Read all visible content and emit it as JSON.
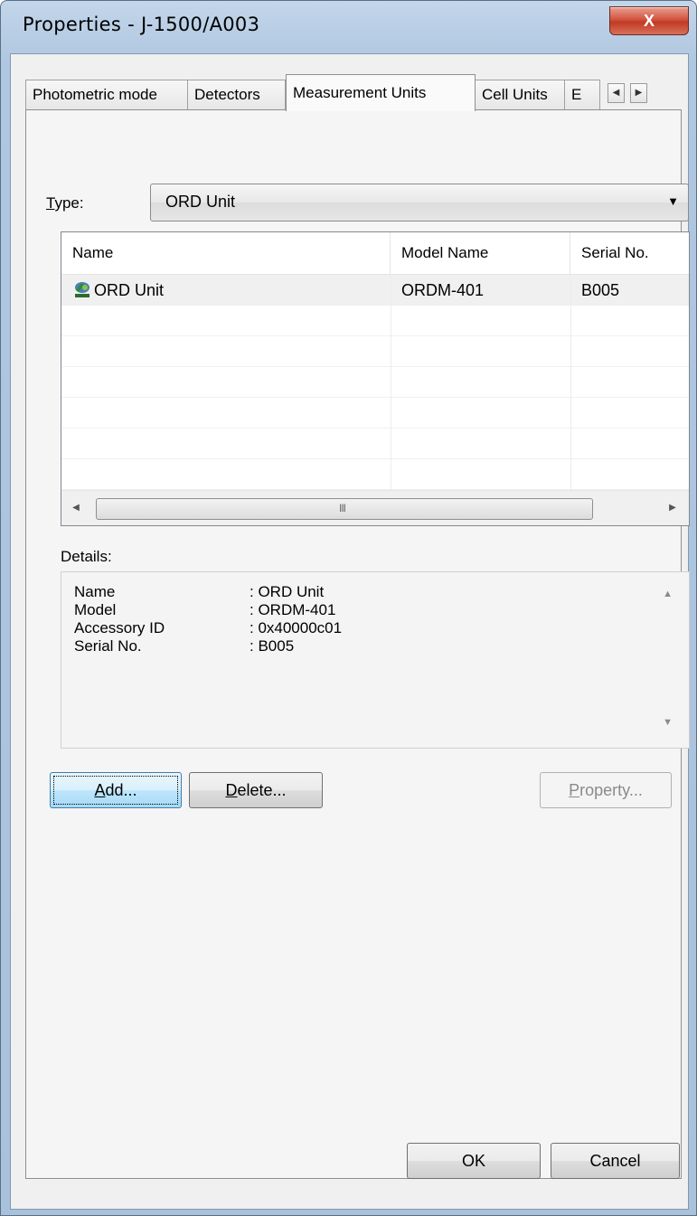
{
  "window": {
    "title": "Properties - J-1500/A003",
    "close_glyph": "X"
  },
  "tabs": [
    {
      "label": "Photometric mode"
    },
    {
      "label": "Detectors"
    },
    {
      "label": "Measurement Units"
    },
    {
      "label": "Cell Units"
    },
    {
      "label": "E"
    }
  ],
  "tab_scroll": {
    "left": "◀",
    "right": "▶"
  },
  "type_field": {
    "label_prefix": "T",
    "label_rest": "ype:",
    "value": "ORD Unit",
    "arrow": "▼"
  },
  "units_table": {
    "columns": [
      "Name",
      "Model Name",
      "Serial No."
    ],
    "rows": [
      {
        "name": "ORD Unit",
        "model": "ORDM-401",
        "serial": "B005",
        "icon": "accessory-icon"
      }
    ],
    "scroll": {
      "left": "◀",
      "right": "▶",
      "grip": "III"
    }
  },
  "details": {
    "label": "Details:",
    "fields": [
      {
        "key": "Name",
        "value": ": ORD Unit"
      },
      {
        "key": "Model",
        "value": ": ORDM-401"
      },
      {
        "key": "Accessory ID",
        "value": ": 0x40000c01"
      },
      {
        "key": "Serial No.",
        "value": ": B005"
      }
    ],
    "scroll": {
      "up": "▲",
      "down": "▼"
    }
  },
  "buttons": {
    "add": {
      "mnemonic": "A",
      "rest": "dd..."
    },
    "delete": {
      "mnemonic": "D",
      "rest": "elete..."
    },
    "property": {
      "mnemonic": "P",
      "rest": "roperty..."
    },
    "ok": "OK",
    "cancel": "Cancel"
  },
  "colors": {
    "frame": "#b7cde4",
    "close_button": "#c23a22",
    "dialog_bg": "#f0f0f0",
    "focus_button": "#bee6fd"
  }
}
